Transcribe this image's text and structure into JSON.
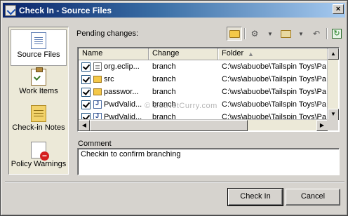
{
  "window": {
    "title": "Check In - Source Files",
    "close_glyph": "×"
  },
  "nav": {
    "items": [
      {
        "label": "Source Files",
        "icon": "source-files-icon",
        "active": true
      },
      {
        "label": "Work Items",
        "icon": "work-items-icon",
        "active": false
      },
      {
        "label": "Check-in Notes",
        "icon": "checkin-notes-icon",
        "active": false
      },
      {
        "label": "Policy Warnings",
        "icon": "policy-warnings-icon",
        "active": false
      }
    ]
  },
  "pending": {
    "label": "Pending changes:",
    "columns": {
      "name": "Name",
      "change": "Change",
      "folder": "Folder",
      "sort_glyph": "▲"
    },
    "rows": [
      {
        "checked": true,
        "icon": "file-icon",
        "name": "org.eclip...",
        "change": "branch",
        "folder": "C:\\ws\\abuobe\\Tailspin Toys\\Pa"
      },
      {
        "checked": true,
        "icon": "folder-icon",
        "name": "src",
        "change": "branch",
        "folder": "C:\\ws\\abuobe\\Tailspin Toys\\Pa"
      },
      {
        "checked": true,
        "icon": "folder-icon",
        "name": "passwor...",
        "change": "branch",
        "folder": "C:\\ws\\abuobe\\Tailspin Toys\\Pa"
      },
      {
        "checked": true,
        "icon": "java-file-icon",
        "name": "PwdValid...",
        "change": "branch",
        "folder": "C:\\ws\\abuobe\\Tailspin Toys\\Pa"
      },
      {
        "checked": true,
        "icon": "java-file-icon",
        "name": "PwdValid...",
        "change": "branch",
        "folder": "C:\\ws\\abuobe\\Tailspin Toys\\Pa"
      }
    ]
  },
  "watermark": "© DotNetCurry.com",
  "comment": {
    "label": "Comment",
    "value": "Checkin to confirm branching"
  },
  "buttons": {
    "checkin": "Check In",
    "cancel": "Cancel"
  },
  "colors": {
    "title_start": "#0a246a",
    "title_end": "#a6caf0",
    "dialog_bg": "#d6d3ce"
  }
}
